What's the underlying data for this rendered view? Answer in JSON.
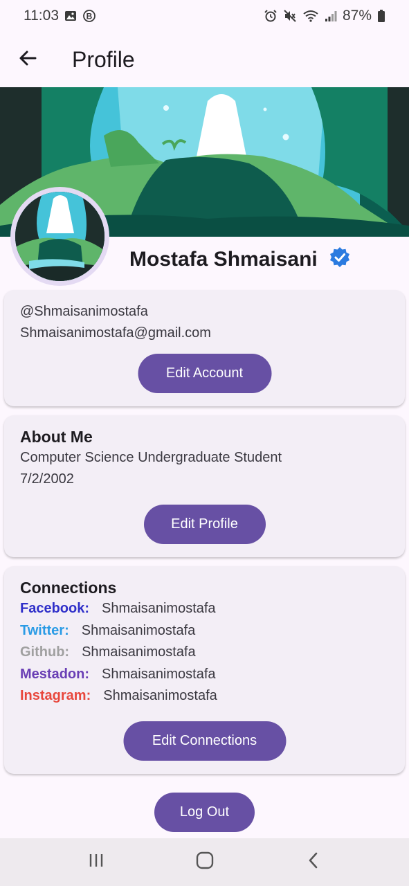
{
  "status_bar": {
    "time": "11:03",
    "battery": "87%",
    "icons": [
      "image-icon",
      "b-circle-icon",
      "alarm-icon",
      "mute-icon",
      "wifi-icon",
      "signal-icon",
      "battery-icon"
    ]
  },
  "app_bar": {
    "title": "Profile",
    "back_icon": "arrow-left-icon"
  },
  "profile": {
    "name": "Mostafa Shmaisani",
    "verified_icon": "verified-badge-icon"
  },
  "account": {
    "handle": "@Shmaisanimostafa",
    "email": "Shmaisanimostafa@gmail.com",
    "button_label": "Edit Account"
  },
  "about": {
    "heading": "About Me",
    "bio": "Computer Science Undergraduate Student",
    "birthdate": "7/2/2002",
    "button_label": "Edit Profile"
  },
  "connections": {
    "heading": "Connections",
    "items": [
      {
        "label": "Facebook:",
        "value": "Shmaisanimostafa",
        "color": "#2f2fc9"
      },
      {
        "label": "Twitter:",
        "value": "Shmaisanimostafa",
        "color": "#2a9be5"
      },
      {
        "label": "Github:",
        "value": "Shmaisanimostafa",
        "color": "#a0a0a0"
      },
      {
        "label": "Mestadon:",
        "value": "Shmaisanimostafa",
        "color": "#6a3fb5"
      },
      {
        "label": "Instagram:",
        "value": "Shmaisanimostafa",
        "color": "#e8473c"
      }
    ],
    "button_label": "Edit Connections"
  },
  "logout_label": "Log Out",
  "colors": {
    "primary": "#6750a4",
    "card_bg": "#f3eef6",
    "page_bg": "#fdf7fe",
    "verified": "#2b7be0"
  },
  "nav_bar": {
    "icons": [
      "recent-apps-icon",
      "home-icon",
      "back-icon"
    ]
  }
}
